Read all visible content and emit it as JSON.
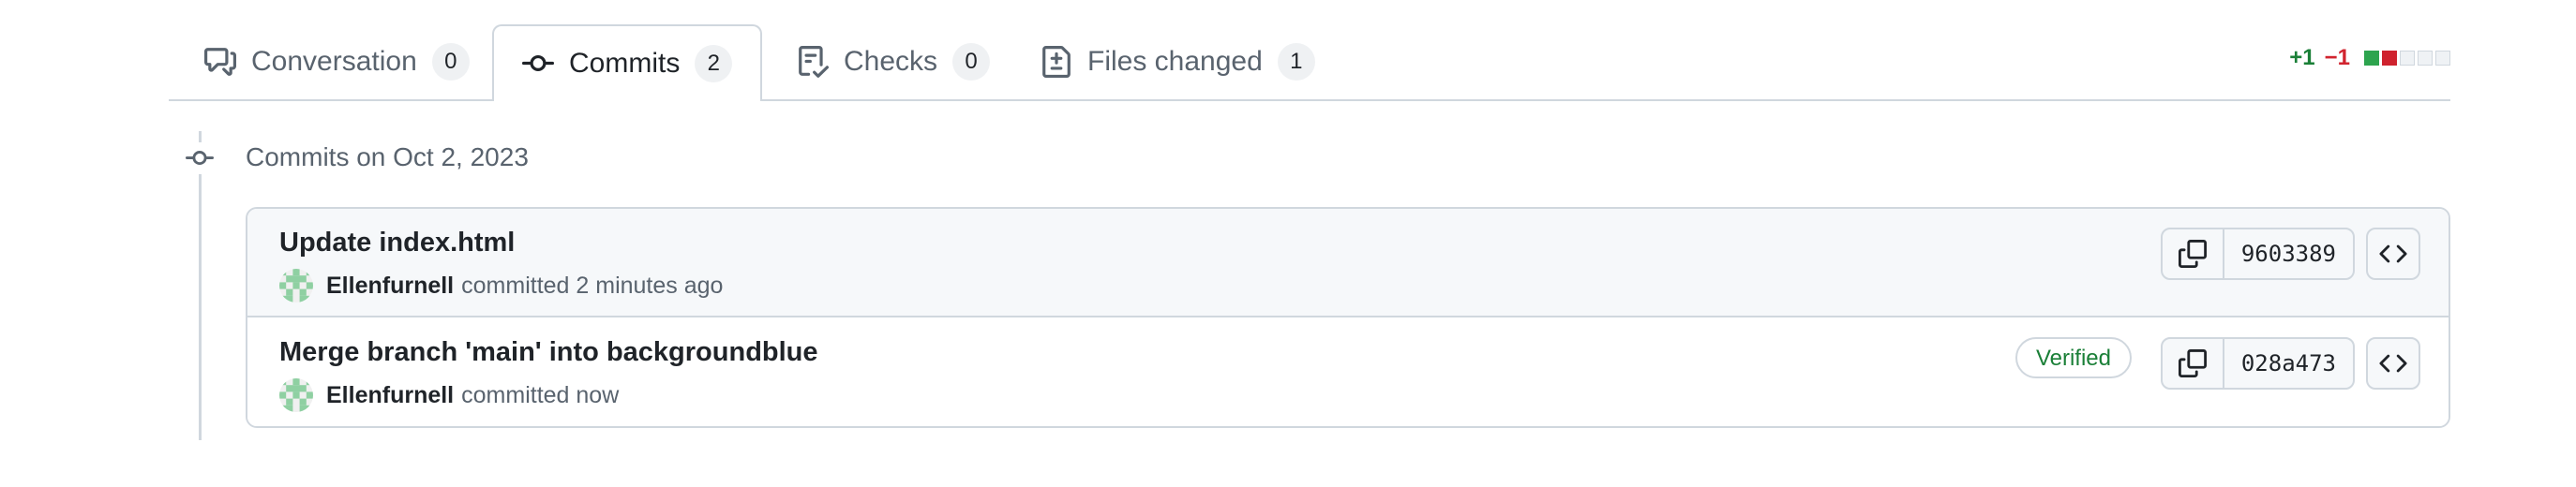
{
  "tabs": [
    {
      "label": "Conversation",
      "count": "0",
      "icon": "comment-discussion-icon"
    },
    {
      "label": "Commits",
      "count": "2",
      "icon": "git-commit-icon"
    },
    {
      "label": "Files changed",
      "count": "1",
      "icon": "file-diff-icon"
    },
    {
      "label": "Checks",
      "count": "0",
      "icon": "checklist-icon"
    }
  ],
  "diffstat": {
    "additions": "+1",
    "deletions": "−1"
  },
  "group": {
    "title": "Commits on Oct 2, 2023"
  },
  "commits": [
    {
      "message": "Update index.html",
      "author": "Ellenfurnell",
      "time": "committed 2 minutes ago",
      "sha": "9603389",
      "verified": ""
    },
    {
      "message": "Merge branch 'main' into backgroundblue",
      "author": "Ellenfurnell",
      "time": "committed now",
      "sha": "028a473",
      "verified": "Verified"
    }
  ],
  "colors": {
    "accent_green": "#1a7f37",
    "accent_red": "#d1242f",
    "border": "#d0d7de",
    "muted": "#59636e"
  }
}
